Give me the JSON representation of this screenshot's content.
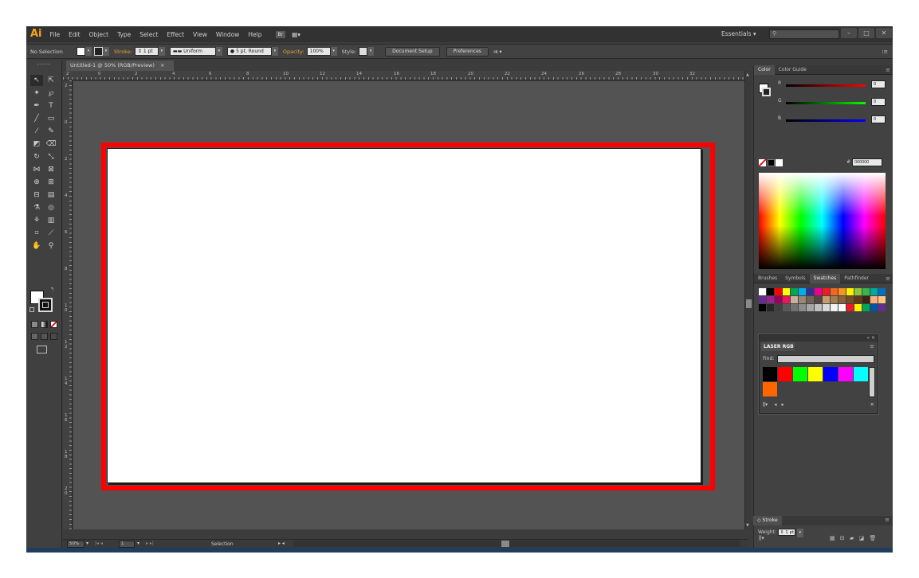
{
  "menubar": {
    "logo": "Ai",
    "items": [
      "File",
      "Edit",
      "Object",
      "Type",
      "Select",
      "Effect",
      "View",
      "Window",
      "Help"
    ],
    "badge": "Br",
    "workspace": "Essentials",
    "search_placeholder": ""
  },
  "controlbar": {
    "selection": "No Selection",
    "stroke_label": "Stroke:",
    "stroke_weight": "1 pt",
    "profile": "Uniform",
    "brush": "5 pt. Round",
    "opacity_label": "Opacity:",
    "opacity_value": "100%",
    "style_label": "Style:",
    "doc_setup": "Document Setup",
    "preferences": "Preferences"
  },
  "document": {
    "tab_title": "Untitled-1 @ 50% (RGB/Preview)",
    "close": "×"
  },
  "ruler": {
    "top_labels": [
      "2",
      "0",
      "2",
      "4",
      "6",
      "8",
      "10",
      "12",
      "14",
      "16",
      "18",
      "20",
      "22",
      "24",
      "26",
      "28",
      "30",
      "32"
    ],
    "left_labels": [
      "2",
      "0",
      "2",
      "4",
      "6",
      "8",
      "1\n0",
      "1\n2",
      "1\n4",
      "1\n6",
      "1\n8",
      "2\n0"
    ]
  },
  "status": {
    "zoom": "50%",
    "page": "1",
    "tool": "Selection"
  },
  "color_panel": {
    "tabs": [
      "Color",
      "Color Guide"
    ],
    "r_label": "R",
    "g_label": "G",
    "b_label": "B",
    "r_value": "0",
    "g_value": "0",
    "b_value": "0",
    "hex_value": "000000"
  },
  "swatches_panel": {
    "tabs": [
      "Brushes",
      "Symbols",
      "Swatches",
      "Pathfinder"
    ],
    "colors": [
      "#ffffff",
      "#000000",
      "#ff0000",
      "#ffff00",
      "#00a650",
      "#00aeef",
      "#2e3192",
      "#ec008c",
      "#ed1c24",
      "#f26522",
      "#f7941d",
      "#fff200",
      "#8dc63f",
      "#39b54a",
      "#00a99d",
      "#0072bc",
      "#662d91",
      "#92278f",
      "#9e005d",
      "#ed145b",
      "#c7b299",
      "#998675",
      "#736357",
      "#534741",
      "#c69c6d",
      "#a67c52",
      "#8c6239",
      "#754c24",
      "#603913",
      "#3c2415",
      "#f9ad81",
      "#fdc689",
      "#000000",
      "#262626",
      "#404040",
      "#595959",
      "#737373",
      "#8c8c8c",
      "#a6a6a6",
      "#bfbfbf",
      "#d9d9d9",
      "#f2f2f2",
      "#ffffff",
      "#ed1c24",
      "#fff200",
      "#00a651",
      "#0054a6",
      "#662d91"
    ]
  },
  "library_panel": {
    "title": "LASER RGB",
    "find_label": "Find:",
    "colors": [
      "#000000",
      "#ff0000",
      "#00ff00",
      "#ffff00",
      "#0000ff",
      "#ff00ff",
      "#00ffff",
      "#ff6600"
    ]
  },
  "stroke_panel": {
    "title": "Stroke",
    "weight_label": "Weight:",
    "weight_value": "1 pt"
  }
}
